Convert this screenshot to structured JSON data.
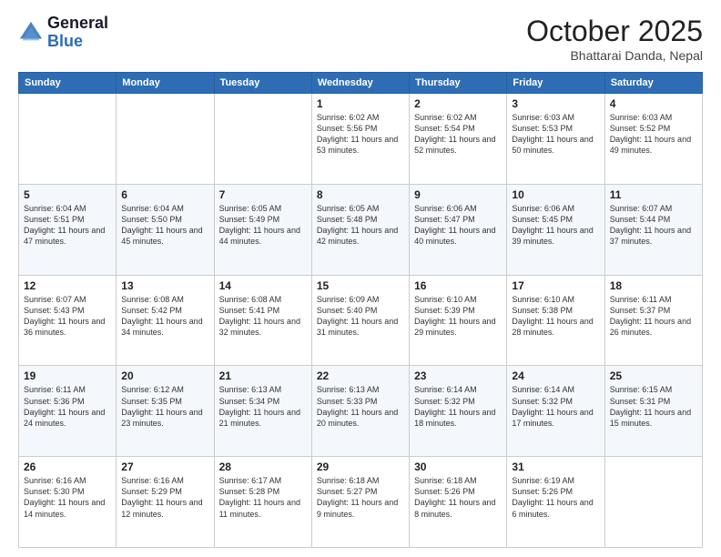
{
  "header": {
    "logo_line1": "General",
    "logo_line2": "Blue",
    "title": "October 2025",
    "subtitle": "Bhattarai Danda, Nepal"
  },
  "weekdays": [
    "Sunday",
    "Monday",
    "Tuesday",
    "Wednesday",
    "Thursday",
    "Friday",
    "Saturday"
  ],
  "weeks": [
    [
      {
        "day": "",
        "info": ""
      },
      {
        "day": "",
        "info": ""
      },
      {
        "day": "",
        "info": ""
      },
      {
        "day": "1",
        "info": "Sunrise: 6:02 AM\nSunset: 5:56 PM\nDaylight: 11 hours\nand 53 minutes."
      },
      {
        "day": "2",
        "info": "Sunrise: 6:02 AM\nSunset: 5:54 PM\nDaylight: 11 hours\nand 52 minutes."
      },
      {
        "day": "3",
        "info": "Sunrise: 6:03 AM\nSunset: 5:53 PM\nDaylight: 11 hours\nand 50 minutes."
      },
      {
        "day": "4",
        "info": "Sunrise: 6:03 AM\nSunset: 5:52 PM\nDaylight: 11 hours\nand 49 minutes."
      }
    ],
    [
      {
        "day": "5",
        "info": "Sunrise: 6:04 AM\nSunset: 5:51 PM\nDaylight: 11 hours\nand 47 minutes."
      },
      {
        "day": "6",
        "info": "Sunrise: 6:04 AM\nSunset: 5:50 PM\nDaylight: 11 hours\nand 45 minutes."
      },
      {
        "day": "7",
        "info": "Sunrise: 6:05 AM\nSunset: 5:49 PM\nDaylight: 11 hours\nand 44 minutes."
      },
      {
        "day": "8",
        "info": "Sunrise: 6:05 AM\nSunset: 5:48 PM\nDaylight: 11 hours\nand 42 minutes."
      },
      {
        "day": "9",
        "info": "Sunrise: 6:06 AM\nSunset: 5:47 PM\nDaylight: 11 hours\nand 40 minutes."
      },
      {
        "day": "10",
        "info": "Sunrise: 6:06 AM\nSunset: 5:45 PM\nDaylight: 11 hours\nand 39 minutes."
      },
      {
        "day": "11",
        "info": "Sunrise: 6:07 AM\nSunset: 5:44 PM\nDaylight: 11 hours\nand 37 minutes."
      }
    ],
    [
      {
        "day": "12",
        "info": "Sunrise: 6:07 AM\nSunset: 5:43 PM\nDaylight: 11 hours\nand 36 minutes."
      },
      {
        "day": "13",
        "info": "Sunrise: 6:08 AM\nSunset: 5:42 PM\nDaylight: 11 hours\nand 34 minutes."
      },
      {
        "day": "14",
        "info": "Sunrise: 6:08 AM\nSunset: 5:41 PM\nDaylight: 11 hours\nand 32 minutes."
      },
      {
        "day": "15",
        "info": "Sunrise: 6:09 AM\nSunset: 5:40 PM\nDaylight: 11 hours\nand 31 minutes."
      },
      {
        "day": "16",
        "info": "Sunrise: 6:10 AM\nSunset: 5:39 PM\nDaylight: 11 hours\nand 29 minutes."
      },
      {
        "day": "17",
        "info": "Sunrise: 6:10 AM\nSunset: 5:38 PM\nDaylight: 11 hours\nand 28 minutes."
      },
      {
        "day": "18",
        "info": "Sunrise: 6:11 AM\nSunset: 5:37 PM\nDaylight: 11 hours\nand 26 minutes."
      }
    ],
    [
      {
        "day": "19",
        "info": "Sunrise: 6:11 AM\nSunset: 5:36 PM\nDaylight: 11 hours\nand 24 minutes."
      },
      {
        "day": "20",
        "info": "Sunrise: 6:12 AM\nSunset: 5:35 PM\nDaylight: 11 hours\nand 23 minutes."
      },
      {
        "day": "21",
        "info": "Sunrise: 6:13 AM\nSunset: 5:34 PM\nDaylight: 11 hours\nand 21 minutes."
      },
      {
        "day": "22",
        "info": "Sunrise: 6:13 AM\nSunset: 5:33 PM\nDaylight: 11 hours\nand 20 minutes."
      },
      {
        "day": "23",
        "info": "Sunrise: 6:14 AM\nSunset: 5:32 PM\nDaylight: 11 hours\nand 18 minutes."
      },
      {
        "day": "24",
        "info": "Sunrise: 6:14 AM\nSunset: 5:32 PM\nDaylight: 11 hours\nand 17 minutes."
      },
      {
        "day": "25",
        "info": "Sunrise: 6:15 AM\nSunset: 5:31 PM\nDaylight: 11 hours\nand 15 minutes."
      }
    ],
    [
      {
        "day": "26",
        "info": "Sunrise: 6:16 AM\nSunset: 5:30 PM\nDaylight: 11 hours\nand 14 minutes."
      },
      {
        "day": "27",
        "info": "Sunrise: 6:16 AM\nSunset: 5:29 PM\nDaylight: 11 hours\nand 12 minutes."
      },
      {
        "day": "28",
        "info": "Sunrise: 6:17 AM\nSunset: 5:28 PM\nDaylight: 11 hours\nand 11 minutes."
      },
      {
        "day": "29",
        "info": "Sunrise: 6:18 AM\nSunset: 5:27 PM\nDaylight: 11 hours\nand 9 minutes."
      },
      {
        "day": "30",
        "info": "Sunrise: 6:18 AM\nSunset: 5:26 PM\nDaylight: 11 hours\nand 8 minutes."
      },
      {
        "day": "31",
        "info": "Sunrise: 6:19 AM\nSunset: 5:26 PM\nDaylight: 11 hours\nand 6 minutes."
      },
      {
        "day": "",
        "info": ""
      }
    ]
  ]
}
